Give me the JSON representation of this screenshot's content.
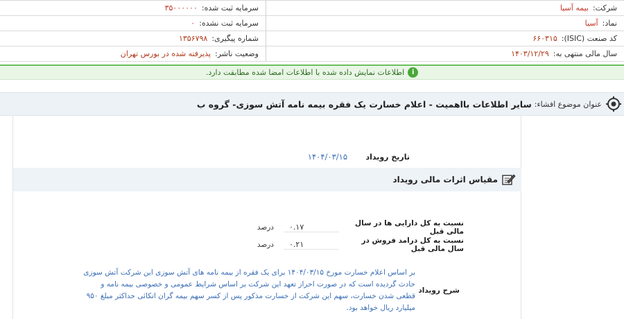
{
  "info": {
    "company_label": "شرکت:",
    "company_value": "بیمه آسیا",
    "registered_capital_label": "سرمایه ثبت شده:",
    "registered_capital_value": "۳۵۰۰۰۰۰۰",
    "symbol_label": "نماد:",
    "symbol_value": "آسیا",
    "unregistered_capital_label": "سرمایه ثبت نشده:",
    "unregistered_capital_value": "۰",
    "isic_label": "کد صنعت (ISIC):",
    "isic_value": "۶۶۰۳۱۵",
    "tracking_label": "شماره پیگیری:",
    "tracking_value": "۱۳۵۶۷۹۸",
    "fiscal_year_label": "سال مالی منتهی به:",
    "fiscal_year_value": "۱۴۰۳/۱۲/۲۹",
    "publisher_status_label": "وضعیت ناشر:",
    "publisher_status_value": "پذیرفته شده در بورس تهران"
  },
  "notice": {
    "text": "اطلاعات نمایش داده شده با اطلاعات امضا شده مطابقت دارد.",
    "icon": "info-icon",
    "color": "#4aa83a"
  },
  "subject": {
    "label": "عنوان موضوع افشاء:",
    "title": "سایر اطلاعات بااهمیت - اعلام خسارت یک فقره بیمه نامه آتش سوزی- گروه ب"
  },
  "event": {
    "date_label": "تاریخ رویداد",
    "date_value": "۱۴۰۴/۰۳/۱۵"
  },
  "section": {
    "title": "مقیاس اثرات مالی رویداد"
  },
  "ratios": [
    {
      "label": "نسبت به کل دارایی ها در سال مالی قبل",
      "value": "۰.۱۷",
      "unit": "درصد"
    },
    {
      "label": "نسبت به کل درامد فروش در سال مالی قبل",
      "value": "۰.۲۱",
      "unit": "درصد"
    }
  ],
  "description": {
    "label": "شرح رویداد",
    "text": "بر اساس اعلام خسارت مورخ ۱۴۰۴/۰۳/۱۵ برای یک فقره از بیمه نامه های آتش سوزی این شرکت آتش سوزی حادث گردیده است که در صورت احراز تعهد این شرکت بر اساس شرایط عمومی و خصوصی بیمه نامه و قطعی شدن خسارت، سهم این شرکت از خسارت مذکور پس از کسر سهم بیمه گران اتکائی حداکثر مبلغ ۹۵۰ میلیارد ریال خواهد بود."
  }
}
